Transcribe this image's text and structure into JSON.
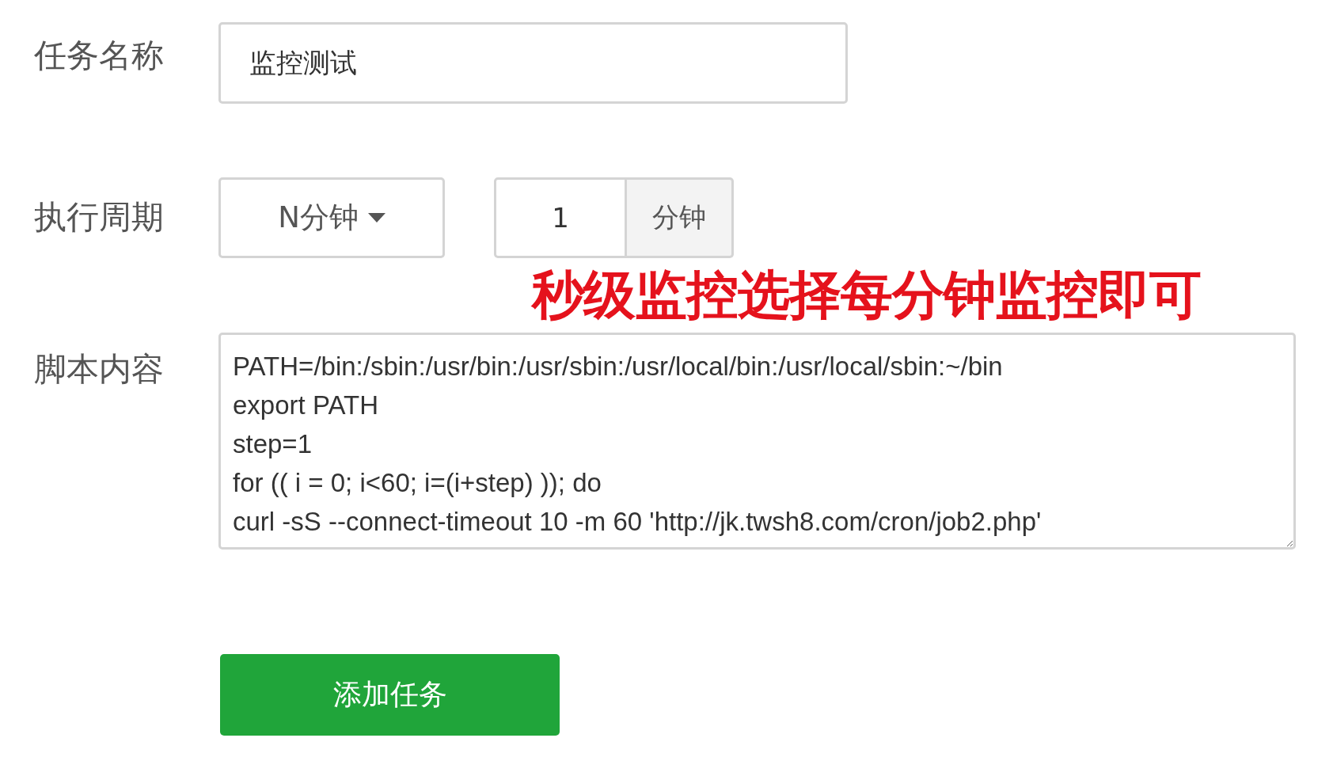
{
  "task_name": {
    "label": "任务名称",
    "value": "监控测试"
  },
  "period": {
    "label": "执行周期",
    "dropdown": "N分钟",
    "number": "1",
    "unit": "分钟"
  },
  "annotation": "秒级监控选择每分钟监控即可",
  "script": {
    "label": "脚本内容",
    "lines": [
      "PATH=/bin:/sbin:/usr/bin:/usr/sbin:/usr/local/bin:/usr/local/sbin:~/bin",
      "export PATH",
      "step=1",
      "for (( i = 0; i<60; i=(i+step) )); do",
      "curl -sS --connect-timeout 10 -m 60 'http://jk.twsh8.com/cron/job2.php'"
    ]
  },
  "submit_button": "添加任务"
}
